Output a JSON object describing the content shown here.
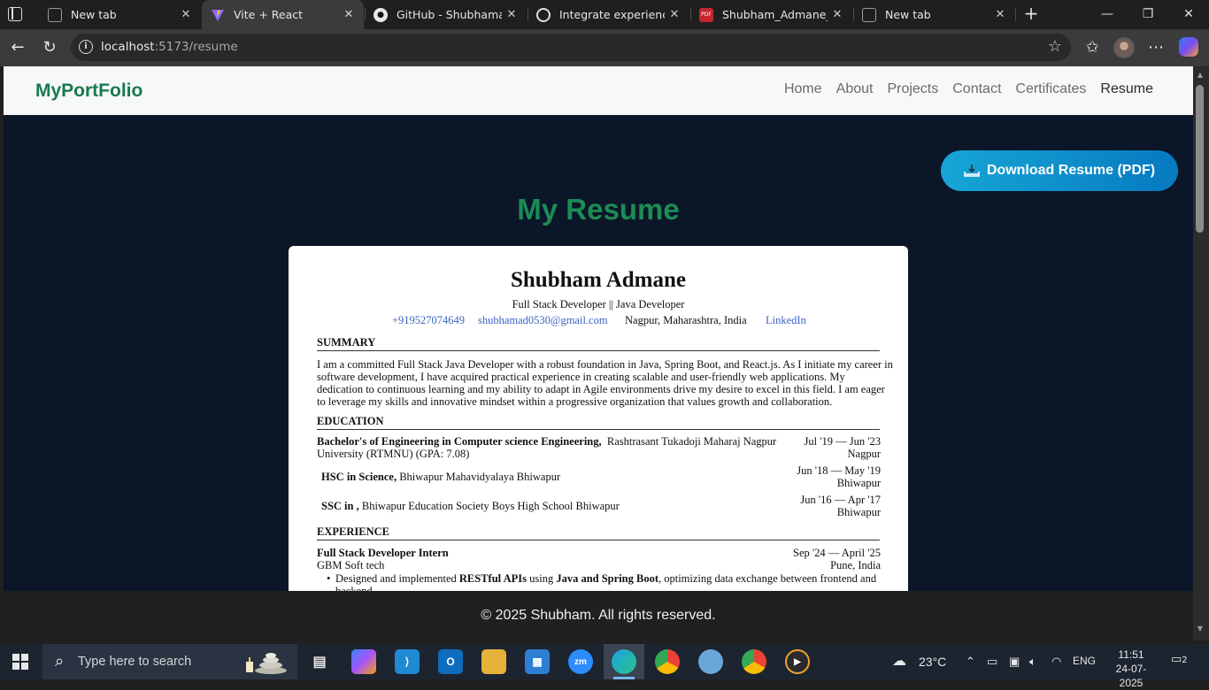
{
  "browser": {
    "tabs": [
      {
        "label": "New tab",
        "icon": "edge-newtab-icon",
        "active": false
      },
      {
        "label": "Vite + React",
        "icon": "vite-icon",
        "active": true
      },
      {
        "label": "GitHub - Shubhamadm",
        "icon": "github-icon",
        "active": false
      },
      {
        "label": "Integrate experience se",
        "icon": "openai-icon",
        "active": false
      },
      {
        "label": "Shubham_Admane_cv.p",
        "icon": "pdf-icon",
        "active": false
      },
      {
        "label": "New tab",
        "icon": "edge-newtab-icon",
        "active": false
      }
    ],
    "url_host": "localhost",
    "url_path": ":5173/resume"
  },
  "site": {
    "brand": "MyPortFolio",
    "nav": [
      "Home",
      "About",
      "Projects",
      "Contact",
      "Certificates",
      "Resume"
    ],
    "active_nav": "Resume",
    "download_label": "Download Resume (PDF)",
    "download_icon": "download-tray-icon",
    "page_title": "My Resume",
    "footer": "© 2025 Shubham. All rights reserved."
  },
  "resume": {
    "name": "Shubham Admane",
    "role": "Full Stack Developer || Java Developer",
    "contact": {
      "phone": "+919527074649",
      "email": "shubhamad0530@gmail.com",
      "location": "Nagpur, Maharashtra, India",
      "linkedin": "LinkedIn"
    },
    "summary_heading": "SUMMARY",
    "summary_lines": [
      "I am a committed Full Stack Java Developer with a robust foundation in Java, Spring Boot, and React.js. As I initiate my career in",
      "software development, I have acquired practical experience in creating scalable and user-friendly web applications. My",
      "dedication to continuous learning and my ability to adapt in Agile environments drive my desire to excel in this field. I am eager",
      "to leverage my skills and innovative mindset within a progressive organization that values growth and collaboration."
    ],
    "education_heading": "EDUCATION",
    "education": [
      {
        "degree": "Bachelor's of Engineering in Computer science Engineering,",
        "school": "Rashtrasant Tukadoji Maharaj Nagpur",
        "school_cont": "University (RTMNU) (GPA: 7.08)",
        "dates": "Jul '19 — Jun '23",
        "place": "Nagpur"
      },
      {
        "degree": "HSC in Science,",
        "school": "Bhiwapur Mahavidyalaya Bhiwapur",
        "dates": "Jun '18 — May '19",
        "place": "Bhiwapur"
      },
      {
        "degree": "SSC in ,",
        "school": "Bhiwapur Education Society Boys High School Bhiwapur",
        "dates": "Jun '16 — Apr '17",
        "place": "Bhiwapur"
      }
    ],
    "experience_heading": "EXPERIENCE",
    "experience": {
      "title": "Full Stack Developer Intern",
      "company": "GBM Soft tech",
      "dates": "Sep '24 — April '25",
      "place": "Pune, India",
      "bullet_a": "Designed and implemented ",
      "bullet_b": "RESTful APIs",
      "bullet_c": " using ",
      "bullet_d": "Java and Spring Boot",
      "bullet_e": ", optimizing data exchange between frontend and",
      "bullet_line2": "backend"
    }
  },
  "taskbar": {
    "search_placeholder": "Type here to search",
    "weather": "23°C",
    "language": "ENG",
    "time": "11:51",
    "date": "24-07-2025",
    "notifications": "2",
    "apps": [
      "copilot",
      "vscode",
      "outlook",
      "file-explorer",
      "microsoft-store",
      "zoom",
      "edge",
      "chrome",
      "paint",
      "chrome-profile",
      "media-player"
    ]
  }
}
